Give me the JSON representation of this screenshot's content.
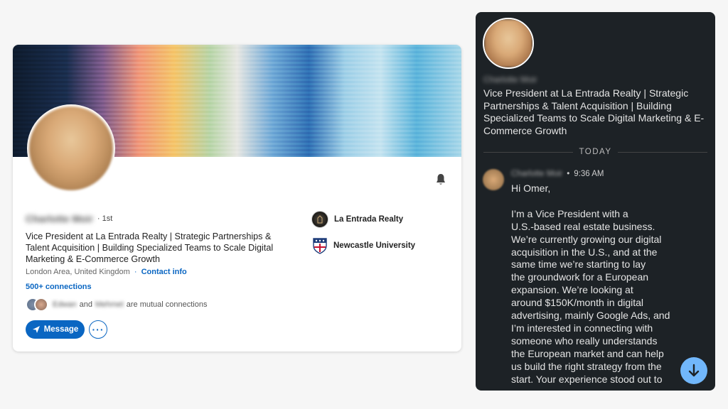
{
  "profile": {
    "name": "Charlotte Moir",
    "degree": "· 1st",
    "headline": "Vice President at La Entrada Realty | Strategic Partnerships & Talent Acquisition | Building Specialized Teams to Scale Digital Marketing & E-Commerce Growth",
    "location": "London Area, United Kingdom",
    "location_separator": "·",
    "contact_info": "Contact info",
    "connections": "500+ connections",
    "mutual": {
      "name1": "Edwan",
      "and": "and",
      "name2": "Mehmet",
      "suffix": "are mutual connections"
    },
    "message_button": "Message",
    "more_button": "···",
    "companies": [
      {
        "name": "La Entrada Realty",
        "icon": "company-logo-icon"
      },
      {
        "name": "Newcastle University",
        "icon": "university-shield-icon"
      }
    ],
    "bell_icon": "bell-icon"
  },
  "chat": {
    "name": "Charlotte Moir",
    "headline": "Vice President at La Entrada Realty | Strategic Partnerships & Talent Acquisition | Building Specialized Teams to Scale Digital Marketing & E-Commerce Growth",
    "divider": "TODAY",
    "message": {
      "sender": "Charlotte Moir",
      "separator": "•",
      "time": "9:36 AM",
      "body": "Hi Omer,\n\nI’m a Vice President with a\nU.S.-based real estate business.\nWe’re currently growing our digital\nacquisition in the U.S., and at the\nsame time we’re starting to lay\nthe groundwork for a European\nexpansion. We’re looking at\naround $150K/month in digital\nadvertising, mainly Google Ads, and\nI’m interested in connecting with\nsomeone who really understands\nthe European market and can help\nus build the right strategy from the\nstart. Your experience stood out to"
    },
    "scroll_icon": "arrow-down-icon"
  },
  "colors": {
    "accent": "#0a66c2",
    "chat_bg": "#1d2226",
    "scroll_button": "#71b7fb"
  }
}
